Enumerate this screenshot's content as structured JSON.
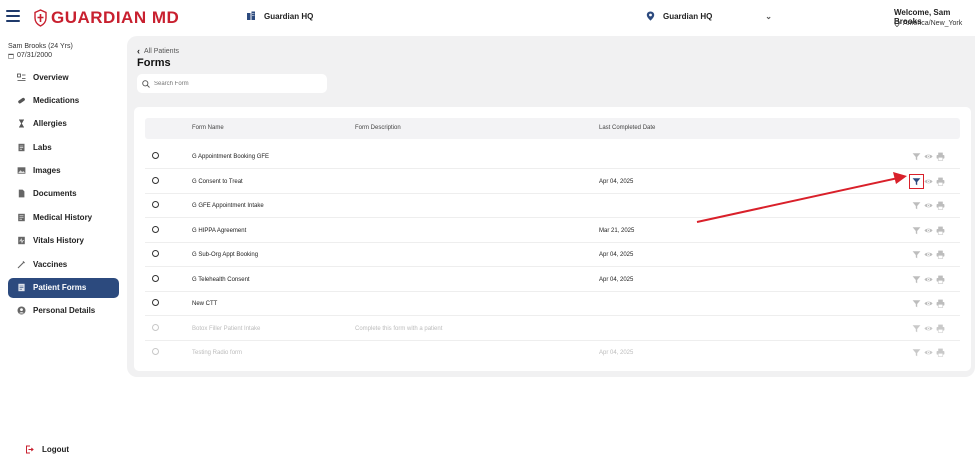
{
  "header": {
    "logo_text": "GUARDIAN MD",
    "org_name": "Guardian HQ",
    "location": "Guardian HQ",
    "welcome": "Welcome, Sam Brooks",
    "timezone": "America/New_York"
  },
  "patient": {
    "name": "Sam Brooks (24 Yrs)",
    "dob": "07/31/2000"
  },
  "sidebar": {
    "items": [
      {
        "label": "Overview",
        "icon": "overview-icon",
        "active": false
      },
      {
        "label": "Medications",
        "icon": "pill-icon",
        "active": false
      },
      {
        "label": "Allergies",
        "icon": "hourglass-icon",
        "active": false
      },
      {
        "label": "Labs",
        "icon": "lab-report-icon",
        "active": false
      },
      {
        "label": "Images",
        "icon": "image-icon",
        "active": false
      },
      {
        "label": "Documents",
        "icon": "document-icon",
        "active": false
      },
      {
        "label": "Medical History",
        "icon": "history-icon",
        "active": false
      },
      {
        "label": "Vitals History",
        "icon": "vitals-icon",
        "active": false
      },
      {
        "label": "Vaccines",
        "icon": "syringe-icon",
        "active": false
      },
      {
        "label": "Patient Forms",
        "icon": "forms-icon",
        "active": true
      },
      {
        "label": "Personal Details",
        "icon": "person-icon",
        "active": false
      }
    ],
    "logout_label": "Logout"
  },
  "main": {
    "back_label": "All Patients",
    "title": "Forms",
    "search_placeholder": "Search Form",
    "table": {
      "headers": {
        "name": "Form Name",
        "description": "Form Description",
        "last_completed": "Last Completed Date"
      },
      "rows": [
        {
          "name": "G Appointment Booking GFE",
          "description": "",
          "date": "",
          "disabled": false
        },
        {
          "name": "G Consent to Treat",
          "description": "",
          "date": "Apr 04, 2025",
          "disabled": false,
          "selected_action": true
        },
        {
          "name": "G GFE Appointment Intake",
          "description": "",
          "date": "",
          "disabled": false
        },
        {
          "name": "G HIPPA Agreement",
          "description": "",
          "date": "Mar 21, 2025",
          "disabled": false
        },
        {
          "name": "G Sub-Org Appt Booking",
          "description": "",
          "date": "Apr 04, 2025",
          "disabled": false
        },
        {
          "name": "G Telehealth Consent",
          "description": "",
          "date": "Apr 04, 2025",
          "disabled": false
        },
        {
          "name": "New CTT",
          "description": "",
          "date": "",
          "disabled": false
        },
        {
          "name": "Botox Filler Patient Intake",
          "description": "Complete this form with a patient",
          "date": "",
          "disabled": true
        },
        {
          "name": "Testing Radio form",
          "description": "",
          "date": "Apr 04, 2025",
          "disabled": true
        }
      ]
    }
  },
  "colors": {
    "brand_red": "#c8202f",
    "nav_active": "#2c4a7e",
    "annotation_red": "#d9202a"
  }
}
